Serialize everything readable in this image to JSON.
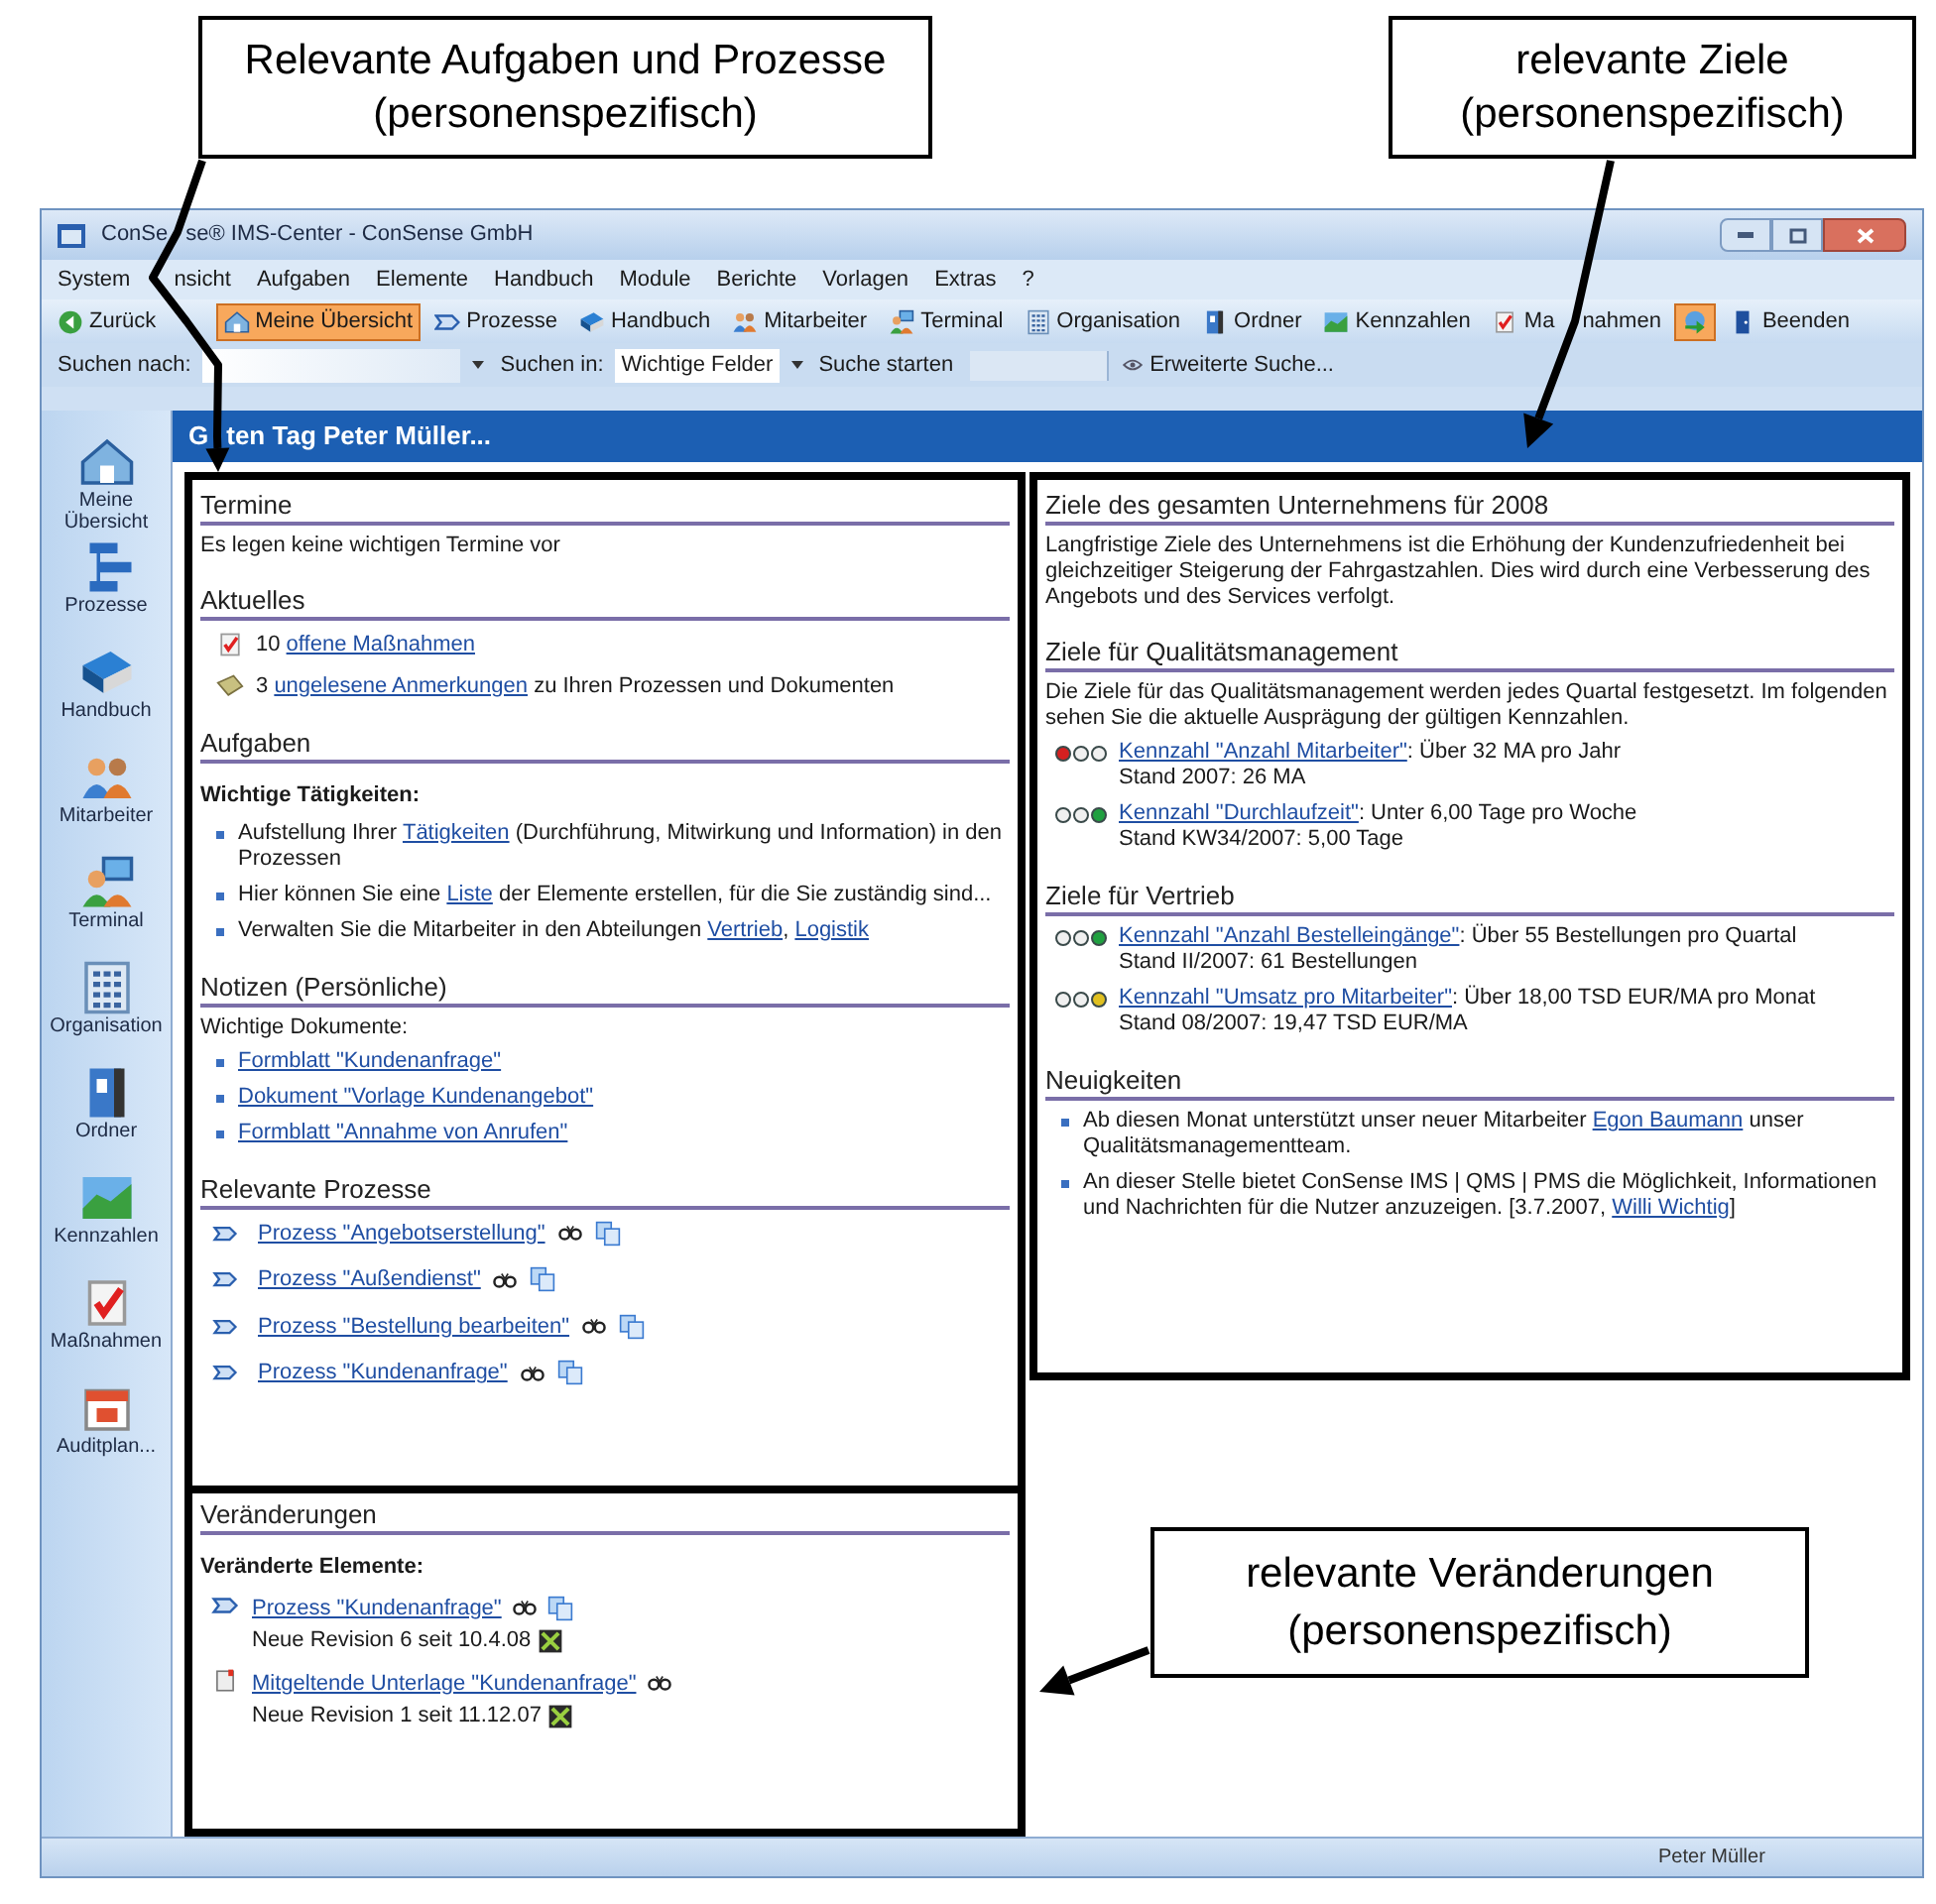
{
  "callouts": [
    {
      "text": "Relevante Aufgaben und Prozesse\n(personenspezifisch)"
    },
    {
      "text": "relevante Ziele\n(personenspezifisch)"
    },
    {
      "text": "relevante Veränderungen\n(personenspezifisch)"
    }
  ],
  "window": {
    "title_parts": [
      "ConSe",
      "se® IMS-Center - ConSense GmbH"
    ]
  },
  "menu": [
    "System",
    "nsicht",
    "Aufgaben",
    "Elemente",
    "Handbuch",
    "Module",
    "Berichte",
    "Vorlagen",
    "Extras",
    "?"
  ],
  "toolbar": [
    {
      "label": "Zurück",
      "selected": false
    },
    {
      "label": "Meine Übersicht",
      "selected": true
    },
    {
      "label": "Prozesse",
      "selected": false
    },
    {
      "label": "Handbuch",
      "selected": false
    },
    {
      "label": "Mitarbeiter",
      "selected": false
    },
    {
      "label": "Terminal",
      "selected": false
    },
    {
      "label": "Organisation",
      "selected": false
    },
    {
      "label": "Ordner",
      "selected": false
    },
    {
      "label": "Kennzahlen",
      "selected": false
    },
    {
      "label": "Ma",
      "label_after": "nahmen",
      "selected": false
    },
    {
      "selected": true
    },
    {
      "label": "Beenden",
      "selected": false
    }
  ],
  "search": {
    "label": "Suchen nach:",
    "scope_label": "Suchen in:",
    "scope_value": "Wichtige Felder",
    "start": "Suche starten",
    "advanced": "Erweiterte Suche..."
  },
  "sidebar": [
    {
      "label": "Meine Übersicht"
    },
    {
      "label": "Prozesse"
    },
    {
      "label": "Handbuch"
    },
    {
      "label": "Mitarbeiter"
    },
    {
      "label": "Terminal"
    },
    {
      "label": "Organisation"
    },
    {
      "label": "Ordner"
    },
    {
      "label": "Kennzahlen"
    },
    {
      "label": "Maßnahmen"
    },
    {
      "label": "Auditplan..."
    }
  ],
  "greeting_parts": [
    "G",
    "ten Tag Peter Müller..."
  ],
  "left_sections": [
    {
      "title": "Termine",
      "blocks": [
        {
          "kind": "text",
          "text": "Es legen keine wichtigen Termine vor"
        }
      ]
    },
    {
      "title": "Aktuelles",
      "blocks": [
        {
          "kind": "icon_line",
          "segments": [
            {
              "text": "10 ",
              "link": false
            },
            {
              "text": "offene Maßnahmen",
              "link": true
            }
          ]
        },
        {
          "kind": "icon_line",
          "segments": [
            {
              "text": "3 ",
              "link": false
            },
            {
              "text": "ungelesene Anmerkungen",
              "link": true
            },
            {
              "text": " zu Ihren Prozessen und Dokumenten",
              "link": false
            }
          ]
        }
      ]
    },
    {
      "title": "Aufgaben",
      "blocks": [
        {
          "kind": "subheading",
          "text": "Wichtige Tätigkeiten:"
        },
        {
          "kind": "bullet",
          "segments": [
            {
              "text": "Aufstellung Ihrer ",
              "link": false
            },
            {
              "text": "Tätigkeiten",
              "link": true
            },
            {
              "text": " (Durchführung, Mitwirkung und Information) in den Prozessen",
              "link": false
            }
          ]
        },
        {
          "kind": "bullet",
          "segments": [
            {
              "text": "Hier können Sie eine ",
              "link": false
            },
            {
              "text": "Liste",
              "link": true
            },
            {
              "text": " der Elemente erstellen, für die Sie zuständig sind...",
              "link": false
            }
          ]
        },
        {
          "kind": "bullet",
          "segments": [
            {
              "text": "Verwalten Sie die Mitarbeiter in den Abteilungen ",
              "link": false
            },
            {
              "text": "Vertrieb",
              "link": true
            },
            {
              "text": ", ",
              "link": false
            },
            {
              "text": "Logistik",
              "link": true
            }
          ]
        }
      ]
    },
    {
      "title": "Notizen (Persönliche)",
      "blocks": [
        {
          "kind": "text",
          "text": "Wichtige Dokumente:"
        },
        {
          "kind": "bullet",
          "segments": [
            {
              "text": "Formblatt \"Kundenanfrage\"",
              "link": true
            }
          ]
        },
        {
          "kind": "bullet",
          "segments": [
            {
              "text": "Dokument \"Vorlage Kundenangebot\"",
              "link": true
            }
          ]
        },
        {
          "kind": "bullet",
          "segments": [
            {
              "text": "Formblatt \"Annahme von Anrufen\"",
              "link": true
            }
          ]
        }
      ]
    },
    {
      "title": "Relevante Prozesse",
      "blocks": [
        {
          "kind": "process",
          "link": "Prozess \"Angebotserstellung\""
        },
        {
          "kind": "process",
          "link": "Prozess \"Außendienst\""
        },
        {
          "kind": "process",
          "link": "Prozess \"Bestellung bearbeiten\""
        },
        {
          "kind": "process",
          "link": "Prozess \"Kundenanfrage\""
        }
      ]
    }
  ],
  "changes_section": {
    "title": "Veränderungen",
    "blocks": [
      {
        "kind": "subheading",
        "text": "Veränderte Elemente:"
      },
      {
        "kind": "change",
        "link": "Prozess \"Kundenanfrage\"",
        "copy": true,
        "revision": "Neue Revision 6 seit 10.4.08"
      },
      {
        "kind": "change",
        "link": "Mitgeltende Unterlage \"Kundenanfrage\"",
        "copy": false,
        "revision": "Neue Revision 1 seit 11.12.07"
      }
    ]
  },
  "right_sections": [
    {
      "title": "Ziele des gesamten Unternehmens für 2008",
      "blocks": [
        {
          "kind": "text",
          "text": "Langfristige Ziele des Unternehmens ist die Erhöhung der Kundenzufriedenheit bei gleichzeitiger Steigerung der Fahrgastzahlen. Dies wird durch eine Verbesserung des Angebots und des Services verfolgt."
        }
      ]
    },
    {
      "title": "Ziele für Qualitätsmanagement",
      "blocks": [
        {
          "kind": "text",
          "text": "Die Ziele für das Qualitätsmanagement werden jedes Quartal festgesetzt. Im folgenden sehen Sie die aktuelle Ausprägung der gültigen Kennzahlen."
        },
        {
          "kind": "kpi",
          "color": "#d42020",
          "link": "Kennzahl \"Anzahl Mitarbeiter\"",
          "text": ": Über 32 MA pro Jahr",
          "stand": "Stand 2007: 26 MA"
        },
        {
          "kind": "kpi",
          "color": "#20a040",
          "link": "Kennzahl \"Durchlaufzeit\"",
          "text": ": Unter 6,00 Tage pro Woche",
          "stand": "Stand KW34/2007: 5,00 Tage"
        }
      ]
    },
    {
      "title": "Ziele für Vertrieb",
      "blocks": [
        {
          "kind": "kpi",
          "color": "#20a040",
          "link": "Kennzahl \"Anzahl Bestelleingänge\"",
          "text": ": Über 55 Bestellungen pro Quartal",
          "stand": "Stand II/2007: 61 Bestellungen"
        },
        {
          "kind": "kpi",
          "color": "#e0c020",
          "link": "Kennzahl \"Umsatz pro Mitarbeiter\"",
          "text": ": Über 18,00 TSD EUR/MA pro Monat",
          "stand": "Stand 08/2007: 19,47 TSD EUR/MA"
        }
      ]
    },
    {
      "title": "Neuigkeiten",
      "blocks": [
        {
          "kind": "bullet",
          "segments": [
            {
              "text": "Ab diesen Monat unterstützt unser neuer Mitarbeiter ",
              "link": false
            },
            {
              "text": "Egon Baumann",
              "link": true
            },
            {
              "text": " unser Qualitätsmanagementteam.",
              "link": false
            }
          ]
        },
        {
          "kind": "bullet",
          "segments": [
            {
              "text": "An dieser Stelle bietet ConSense IMS | QMS | PMS die Möglichkeit, Informationen und Nachrichten für die Nutzer anzuzeigen. [3.7.2007, ",
              "link": false
            },
            {
              "text": "Willi Wichtig",
              "link": true
            },
            {
              "text": "]",
              "link": false
            }
          ]
        }
      ]
    }
  ],
  "status_bar": {
    "user": "Peter Müller"
  }
}
